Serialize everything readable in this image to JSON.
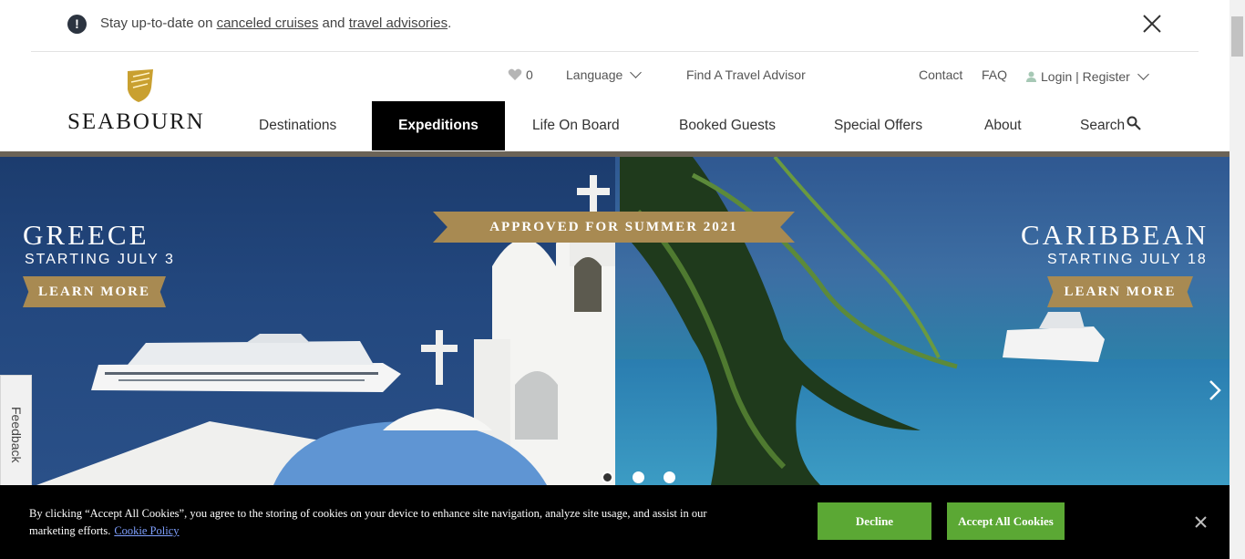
{
  "alert": {
    "prefix": "Stay up-to-date on ",
    "link1": "canceled cruises",
    "middle": " and ",
    "link2": "travel advisories",
    "suffix": ".",
    "icon": "exclamation-icon"
  },
  "logo": {
    "text": "SEABOURN"
  },
  "utility": {
    "favorites_count": "0",
    "language": "Language",
    "travel_advisor": "Find A Travel Advisor",
    "contact": "Contact",
    "faq": "FAQ",
    "login": "Login | Register"
  },
  "nav": {
    "items": [
      "Destinations",
      "Expeditions",
      "Life On Board",
      "Booked Guests",
      "Special Offers",
      "About",
      "Search"
    ],
    "active": "Expeditions"
  },
  "hero": {
    "banner": "APPROVED FOR SUMMER 2021",
    "left": {
      "title": "GREECE",
      "subtitle": "STARTING JULY 3",
      "cta": "LEARN MORE"
    },
    "right": {
      "title": "CARIBBEAN",
      "subtitle": "STARTING JULY 18",
      "cta": "LEARN MORE"
    },
    "slides": 3,
    "active_slide": 1
  },
  "feedback": {
    "label": "Feedback"
  },
  "cookie": {
    "text": "By clicking “Accept All Cookies”, you agree to the storing of cookies on your device to enhance site navigation, analyze site usage, and assist in our marketing efforts.",
    "policy_link": "Cookie Policy",
    "decline": "Decline",
    "accept": "Accept All Cookies"
  },
  "colors": {
    "brand_gold": "#a88a52",
    "nav_active_bg": "#000000",
    "accept_green": "#5ba834"
  }
}
